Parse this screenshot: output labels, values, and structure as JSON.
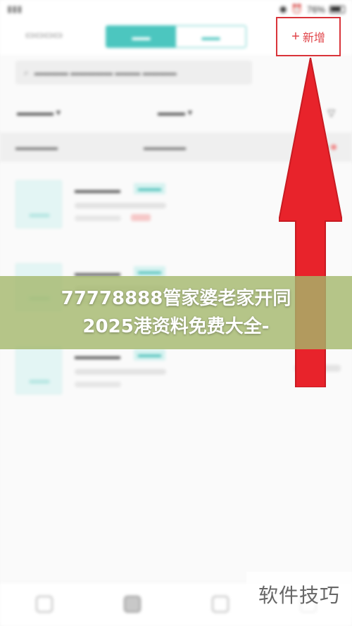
{
  "status_bar": {
    "carrier": "",
    "time": "",
    "battery": "76%"
  },
  "header": {
    "add_button_label": "新增",
    "add_button_icon": "plus-icon"
  },
  "overlay": {
    "headline_line1": "77778888管家婆老家开同",
    "headline_line2": "2025港资料免费大全-",
    "watermark": "软件技巧"
  },
  "annotation": {
    "highlight_color": "#d9343a",
    "arrow_color": "#e8232b",
    "arrow_direction": "up"
  },
  "colors": {
    "accent_teal": "#4cc6bf",
    "banner_bg": "#a4b86c"
  }
}
